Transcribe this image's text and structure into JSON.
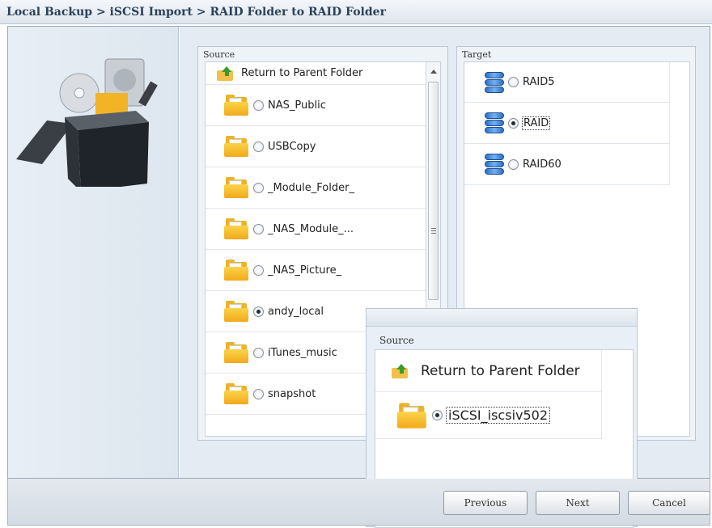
{
  "breadcrumb": "Local Backup > iSCSI Import > RAID Folder to RAID Folder",
  "source_panel": {
    "title": "Source",
    "return_label": "Return to Parent Folder",
    "items": [
      {
        "label": "NAS_Public",
        "checked": false
      },
      {
        "label": "USBCopy",
        "checked": false
      },
      {
        "label": "_Module_Folder_",
        "checked": false
      },
      {
        "label": "_NAS_Module_...",
        "checked": false
      },
      {
        "label": "_NAS_Picture_",
        "checked": false
      },
      {
        "label": "andy_local",
        "checked": true
      },
      {
        "label": "iTunes_music",
        "checked": false
      },
      {
        "label": "snapshot",
        "checked": false
      }
    ]
  },
  "target_panel": {
    "title": "Target",
    "items": [
      {
        "label": "RAID5",
        "checked": false
      },
      {
        "label": "RAID",
        "checked": true
      },
      {
        "label": "RAID60",
        "checked": false
      }
    ]
  },
  "overlay_source": {
    "title": "Source",
    "return_label": "Return to Parent Folder",
    "items": [
      {
        "label": "iSCSI_iscsiv502",
        "checked": true
      }
    ]
  },
  "buttons": {
    "previous": "Previous",
    "next": "Next",
    "cancel": "Cancel"
  }
}
